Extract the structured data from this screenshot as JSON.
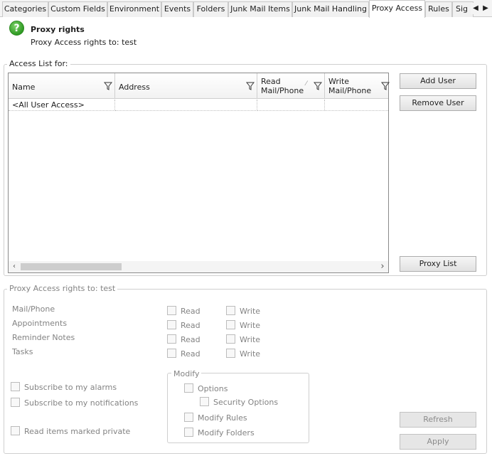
{
  "tabs": [
    {
      "label": "Categories",
      "active": false
    },
    {
      "label": "Custom Fields",
      "active": false
    },
    {
      "label": "Environment",
      "active": false
    },
    {
      "label": "Events",
      "active": false
    },
    {
      "label": "Folders",
      "active": false
    },
    {
      "label": "Junk Mail Items",
      "active": false
    },
    {
      "label": "Junk Mail Handling",
      "active": false
    },
    {
      "label": "Proxy Access",
      "active": true
    },
    {
      "label": "Rules",
      "active": false
    },
    {
      "label": "Sig",
      "active": false
    }
  ],
  "header": {
    "title": "Proxy rights",
    "subtitle": "Proxy Access rights to: test"
  },
  "access_list": {
    "group_label": "Access List for:",
    "columns": [
      {
        "line1": "Name",
        "line2": ""
      },
      {
        "line1": "Address",
        "line2": ""
      },
      {
        "line1": "Read",
        "line2": "Mail/Phone"
      },
      {
        "line1": "Write",
        "line2": "Mail/Phone"
      }
    ],
    "rows": [
      [
        "<All User Access>",
        "",
        "",
        ""
      ]
    ]
  },
  "buttons": {
    "add_user": "Add User",
    "remove_user": "Remove User",
    "proxy_list": "Proxy List",
    "refresh": "Refresh",
    "apply": "Apply"
  },
  "rights": {
    "group_label": "Proxy Access rights to: test",
    "items": [
      {
        "label": "Mail/Phone",
        "read": "Read",
        "write": "Write"
      },
      {
        "label": "Appointments",
        "read": "Read",
        "write": "Write"
      },
      {
        "label": "Reminder Notes",
        "read": "Read",
        "write": "Write"
      },
      {
        "label": "Tasks",
        "read": "Read",
        "write": "Write"
      }
    ],
    "subscribe_alarms": "Subscribe to my alarms",
    "subscribe_notifications": "Subscribe to my notifications",
    "read_private": "Read items marked private",
    "modify": {
      "label": "Modify",
      "options": "Options",
      "security_options": "Security Options",
      "modify_rules": "Modify Rules",
      "modify_folders": "Modify Folders"
    }
  },
  "icons": {
    "help": "help-icon",
    "filter": "filter-icon",
    "scroll_left": "chevron-left-icon",
    "scroll_right": "chevron-right-icon"
  },
  "colors": {
    "help_green": "#2f9a24",
    "disabled_text": "#838383"
  }
}
